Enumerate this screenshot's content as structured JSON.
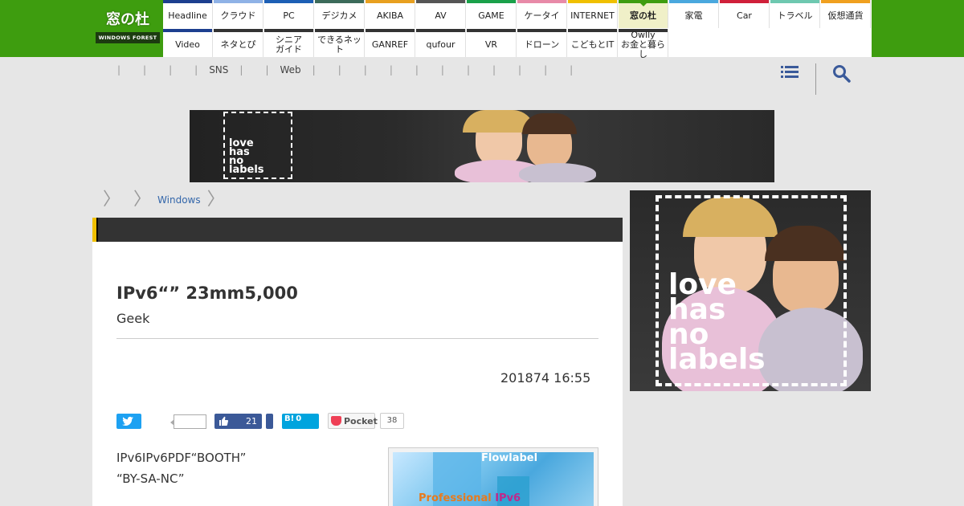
{
  "site": {
    "logo_text": "窓の杜",
    "logo_sub": "WINDOWS FOREST"
  },
  "nav": {
    "row1": [
      {
        "label": "Headline",
        "color": "#1d3f8f"
      },
      {
        "label": "クラウド",
        "color": "#8fb2e6"
      },
      {
        "label": "PC",
        "color": "#1d5fb5"
      },
      {
        "label": "デジカメ",
        "color": "#3c6b5a"
      },
      {
        "label": "AKIBA",
        "color": "#e8a020"
      },
      {
        "label": "AV",
        "color": "#555555"
      },
      {
        "label": "GAME",
        "color": "#1aa14a"
      },
      {
        "label": "ケータイ",
        "color": "#e88aa8"
      },
      {
        "label": "INTERNET",
        "color": "#f0c000"
      },
      {
        "label": "窓の杜",
        "color": "#3e9d0f",
        "active": true
      },
      {
        "label": "家電",
        "color": "#4aa8de"
      },
      {
        "label": "Car",
        "color": "#d0203a"
      },
      {
        "label": "トラベル",
        "color": "#6ec8b0"
      },
      {
        "label": "仮想通貨",
        "color": "#f0a020"
      }
    ],
    "row2": [
      {
        "label": "Video",
        "color": "#1d3f8f"
      },
      {
        "label": "ネタとぴ",
        "color": "#333333"
      },
      {
        "label": "シニア\nガイド",
        "color": "#333333"
      },
      {
        "label": "できるネット",
        "color": "#333333"
      },
      {
        "label": "GANREF",
        "color": "#333333"
      },
      {
        "label": "qufour",
        "color": "#333333"
      },
      {
        "label": "VR",
        "color": "#333333"
      },
      {
        "label": "ドローン",
        "color": "#333333"
      },
      {
        "label": "こどもとIT",
        "color": "#333333"
      },
      {
        "label": "Owlly\nお金と暮らし",
        "color": "#333333"
      }
    ]
  },
  "subnav": {
    "items": [
      "",
      "",
      "",
      "",
      "SNS",
      "",
      "Web",
      "",
      "",
      "",
      "",
      "",
      "",
      "",
      "",
      "",
      "",
      ""
    ]
  },
  "banner": {
    "text_line1": "love",
    "text_line2": "has",
    "text_line3": "no",
    "text_line4": "labels"
  },
  "breadcrumb": {
    "items": [
      "",
      "Windows"
    ]
  },
  "article": {
    "title": "IPv6“” 23mm5,000",
    "subtitle": "Geek",
    "date": "201874 16:55",
    "social": {
      "facebook_count": "21",
      "hatena_label": "B!",
      "hatena_count": "0",
      "pocket_label": "Pocket",
      "pocket_count": "38"
    },
    "body_line1": "IPv6IPv6PDF“BOOTH”",
    "body_line2": "“BY-SA-NC”",
    "figure": {
      "top_text": "Flowlabel",
      "bottom_text": "Professional ",
      "bottom_highlight": "IPv6"
    }
  }
}
